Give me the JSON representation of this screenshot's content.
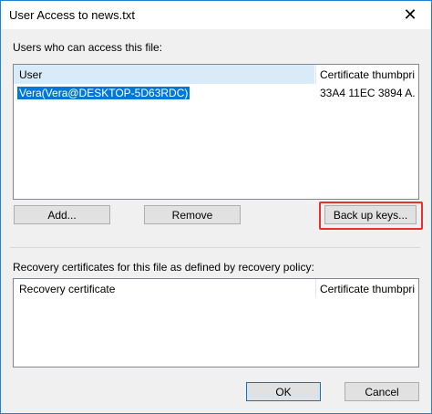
{
  "window": {
    "title": "User Access to news.txt",
    "close_glyph": "✕"
  },
  "users": {
    "label": "Users who can access this file:",
    "columns": [
      "User",
      "Certificate thumbpri"
    ],
    "rows": [
      {
        "user": "Vera(Vera@DESKTOP-5D63RDC)",
        "thumbprint": "33A4 11EC 3894 A..."
      }
    ]
  },
  "buttons": {
    "add": "Add...",
    "remove": "Remove",
    "backup": "Back up keys...",
    "ok": "OK",
    "cancel": "Cancel"
  },
  "recovery": {
    "label": "Recovery certificates for this file as defined by recovery policy:",
    "columns": [
      "Recovery certificate",
      "Certificate thumbpri"
    ]
  },
  "colors": {
    "selection": "#0078d7",
    "highlight": "#e4322b",
    "accent": "#1883d7"
  }
}
